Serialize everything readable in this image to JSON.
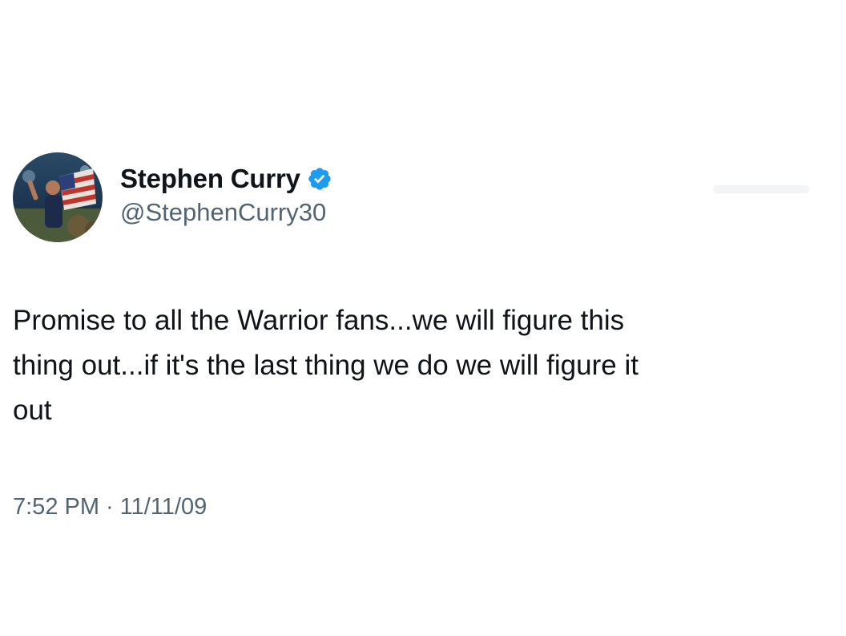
{
  "tweet": {
    "author": {
      "display_name": "Stephen Curry",
      "handle": "@StephenCurry30",
      "verified": true,
      "verified_badge_color": "#1d9bf0",
      "avatar_icon": "profile-photo-icon"
    },
    "text": "Promise to all the Warrior fans...we will figure this\nthing out...if it's the last thing we do we will figure it\nout",
    "time": "7:52 PM",
    "separator": "·",
    "date": "11/11/09"
  },
  "colors": {
    "text_primary": "#0f1419",
    "text_secondary": "#536471",
    "background": "#ffffff"
  }
}
